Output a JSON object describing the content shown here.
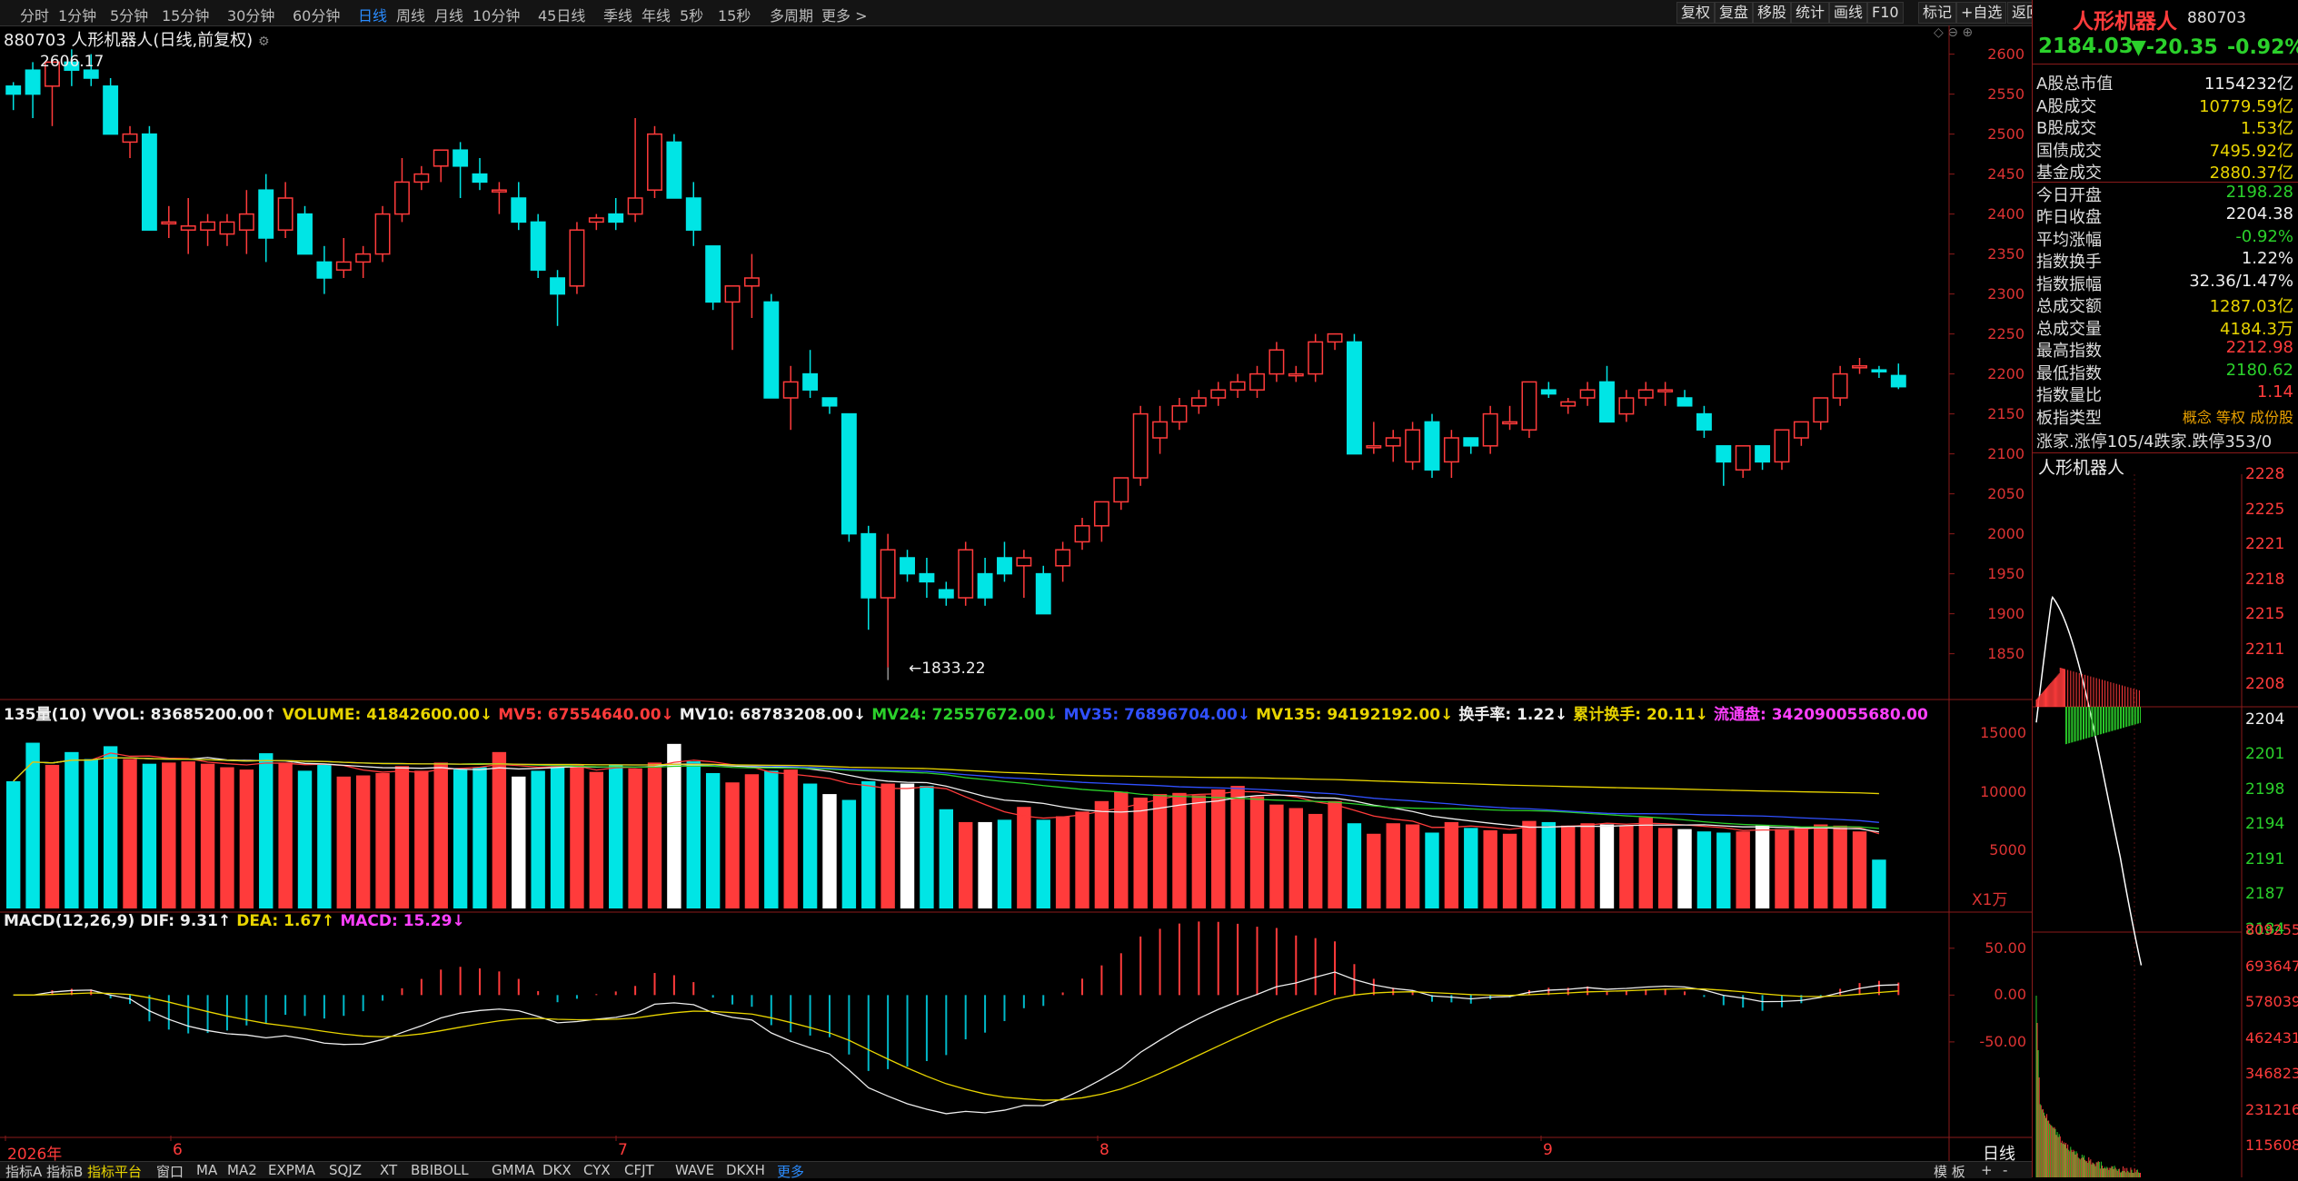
{
  "toolbar": {
    "timeframes": [
      "分时",
      "1分钟",
      "5分钟",
      "15分钟",
      "30分钟",
      "60分钟",
      "日线",
      "周线",
      "月线",
      "10分钟",
      "45日线",
      "季线",
      "年线",
      "5秒",
      "15秒",
      "多周期",
      "更多 >"
    ],
    "active": "日线",
    "right_buttons": [
      "复权",
      "复盘",
      "移股",
      "统计",
      "画线",
      "F10",
      "标记",
      "+自选",
      "返回"
    ]
  },
  "chart_header": {
    "code_title": "880703 人形机器人(日线,前复权)"
  },
  "price_axis": [
    "2600",
    "2550",
    "2500",
    "2450",
    "2400",
    "2350",
    "2300",
    "2250",
    "2200",
    "2150",
    "2100",
    "2050",
    "2000",
    "1950",
    "1900",
    "1850"
  ],
  "annotations": {
    "high": "2606.17",
    "low": "←1833.22"
  },
  "volume_legend": [
    {
      "text": "135量(10) VVOL: 83685200.00↑",
      "color": "#eeeeee"
    },
    {
      "text": "VOLUME: 41842600.00↓",
      "color": "#e8d400"
    },
    {
      "text": "MV5: 67554640.00↓",
      "color": "#ff3b3b"
    },
    {
      "text": "MV10: 68783208.00↓",
      "color": "#eeeeee"
    },
    {
      "text": "MV24: 72557672.00↓",
      "color": "#2bd12b"
    },
    {
      "text": "MV35: 76896704.00↓",
      "color": "#3050ff"
    },
    {
      "text": "MV135: 94192192.00↓",
      "color": "#e8d400"
    },
    {
      "text": "换手率: 1.22↓",
      "color": "#eeeeee"
    },
    {
      "text": "累计换手: 20.11↓",
      "color": "#e8d400"
    },
    {
      "text": "流通盘: 342090055680.00",
      "color": "#ff40ff"
    }
  ],
  "volume_axis": [
    "15000",
    "10000",
    "5000"
  ],
  "volume_unit": "X1万",
  "macd_legend": [
    {
      "text": "MACD(12,26,9) DIF: 9.31↑",
      "color": "#eeeeee"
    },
    {
      "text": "DEA: 1.67↑",
      "color": "#e8d400"
    },
    {
      "text": "MACD: 15.29↓",
      "color": "#ff40ff"
    }
  ],
  "macd_axis": [
    "50.00",
    "0.00",
    "-50.00"
  ],
  "date_axis": [
    {
      "label": "2026年",
      "color": "#ff3b3b"
    },
    {
      "label": "6",
      "color": "#ff3b3b"
    },
    {
      "label": "7",
      "color": "#ff3b3b"
    },
    {
      "label": "8",
      "color": "#ff3b3b"
    },
    {
      "label": "9",
      "color": "#ff3b3b"
    }
  ],
  "period_label": "日线",
  "bottom_tabs": [
    "指标A",
    "指标B",
    "指标平台",
    "窗口",
    "MA",
    "MA2",
    "EXPMA",
    "SQJZ",
    "XT",
    "BBIBOLL",
    "GMMA",
    "DKX",
    "CYX",
    "CFJT",
    "WAVE",
    "DKXH",
    "更多"
  ],
  "bottom_right": [
    "模 板",
    "+",
    "-"
  ],
  "info": {
    "name": "人形机器人",
    "code": "880703",
    "price": "2184.03",
    "change": "▼-20.35",
    "pct": "-0.92%",
    "rows": [
      {
        "k": "A股总市值",
        "v": "1154232亿",
        "c": "#eeeeee"
      },
      {
        "k": "A股成交",
        "v": "10779.59亿",
        "c": "#e8d400"
      },
      {
        "k": "B股成交",
        "v": "1.53亿",
        "c": "#e8d400"
      },
      {
        "k": "国债成交",
        "v": "7495.92亿",
        "c": "#e8d400"
      },
      {
        "k": "基金成交",
        "v": "2880.37亿",
        "c": "#e8d400"
      },
      {
        "k": "今日开盘",
        "v": "2198.28",
        "c": "#2bd12b"
      },
      {
        "k": "昨日收盘",
        "v": "2204.38",
        "c": "#eeeeee"
      },
      {
        "k": "平均涨幅",
        "v": "-0.92%",
        "c": "#2bd12b"
      },
      {
        "k": "指数换手",
        "v": "1.22%",
        "c": "#eeeeee"
      },
      {
        "k": "指数振幅",
        "v": "32.36/1.47%",
        "c": "#eeeeee"
      },
      {
        "k": "总成交额",
        "v": "1287.03亿",
        "c": "#e8d400"
      },
      {
        "k": "总成交量",
        "v": "4184.3万",
        "c": "#e8d400"
      },
      {
        "k": "最高指数",
        "v": "2212.98",
        "c": "#ff3b3b"
      },
      {
        "k": "最低指数",
        "v": "2180.62",
        "c": "#2bd12b"
      },
      {
        "k": "指数量比",
        "v": "1.14",
        "c": "#ff3b3b"
      }
    ],
    "sector_type_label": "板指类型",
    "sector_type_value": "概念 等权 成份股",
    "updown": "涨家.涨停105/4跌家.跌停353/0",
    "mini_title": "人形机器人",
    "mini_price_axis": [
      "2228",
      "2225",
      "2221",
      "2218",
      "2215",
      "2211",
      "2208",
      "2204",
      "2201",
      "2198",
      "2194",
      "2191",
      "2187",
      "2184"
    ],
    "mini_vol_axis": [
      "809255",
      "693647",
      "578039",
      "462431",
      "346823",
      "231216",
      "115608"
    ]
  },
  "chart_data": {
    "type": "candlestick",
    "price_range": [
      1820,
      2620
    ],
    "candles": [
      [
        2560,
        2565,
        2530,
        2550
      ],
      [
        2580,
        2590,
        2520,
        2550
      ],
      [
        2560,
        2580,
        2510,
        2590
      ],
      [
        2590,
        2606,
        2560,
        2580
      ],
      [
        2580,
        2600,
        2560,
        2570
      ],
      [
        2560,
        2570,
        2500,
        2500
      ],
      [
        2490,
        2510,
        2470,
        2500
      ],
      [
        2500,
        2510,
        2380,
        2380
      ],
      [
        2390,
        2410,
        2370,
        2390
      ],
      [
        2380,
        2420,
        2350,
        2385
      ],
      [
        2380,
        2400,
        2360,
        2390
      ],
      [
        2375,
        2400,
        2360,
        2390
      ],
      [
        2380,
        2430,
        2350,
        2400
      ],
      [
        2430,
        2450,
        2340,
        2370
      ],
      [
        2380,
        2440,
        2370,
        2420
      ],
      [
        2400,
        2410,
        2350,
        2350
      ],
      [
        2340,
        2360,
        2300,
        2320
      ],
      [
        2330,
        2370,
        2320,
        2340
      ],
      [
        2340,
        2360,
        2320,
        2350
      ],
      [
        2350,
        2410,
        2340,
        2400
      ],
      [
        2400,
        2470,
        2390,
        2440
      ],
      [
        2440,
        2460,
        2430,
        2450
      ],
      [
        2460,
        2480,
        2440,
        2480
      ],
      [
        2480,
        2490,
        2420,
        2460
      ],
      [
        2450,
        2470,
        2430,
        2440
      ],
      [
        2430,
        2440,
        2400,
        2430
      ],
      [
        2420,
        2440,
        2380,
        2390
      ],
      [
        2390,
        2400,
        2320,
        2330
      ],
      [
        2320,
        2330,
        2260,
        2300
      ],
      [
        2310,
        2390,
        2300,
        2380
      ],
      [
        2390,
        2400,
        2380,
        2395
      ],
      [
        2400,
        2420,
        2380,
        2390
      ],
      [
        2400,
        2520,
        2390,
        2420
      ],
      [
        2430,
        2510,
        2420,
        2500
      ],
      [
        2490,
        2500,
        2420,
        2420
      ],
      [
        2420,
        2440,
        2360,
        2380
      ],
      [
        2360,
        2360,
        2280,
        2290
      ],
      [
        2290,
        2300,
        2230,
        2310
      ],
      [
        2310,
        2350,
        2270,
        2320
      ],
      [
        2290,
        2300,
        2170,
        2170
      ],
      [
        2170,
        2210,
        2130,
        2190
      ],
      [
        2200,
        2230,
        2170,
        2180
      ],
      [
        2170,
        2170,
        2150,
        2160
      ],
      [
        2150,
        2150,
        1990,
        2000
      ],
      [
        2000,
        2010,
        1880,
        1920
      ],
      [
        1920,
        2000,
        1833,
        1980
      ],
      [
        1970,
        1980,
        1940,
        1950
      ],
      [
        1950,
        1970,
        1920,
        1940
      ],
      [
        1930,
        1940,
        1910,
        1920
      ],
      [
        1920,
        1990,
        1910,
        1980
      ],
      [
        1950,
        1970,
        1910,
        1920
      ],
      [
        1970,
        1990,
        1940,
        1950
      ],
      [
        1960,
        1980,
        1920,
        1970
      ],
      [
        1950,
        1960,
        1910,
        1900
      ],
      [
        1960,
        1990,
        1940,
        1980
      ],
      [
        1990,
        2020,
        1980,
        2010
      ],
      [
        2010,
        2030,
        1990,
        2040
      ],
      [
        2040,
        2070,
        2030,
        2070
      ],
      [
        2070,
        2160,
        2060,
        2150
      ],
      [
        2120,
        2160,
        2100,
        2140
      ],
      [
        2140,
        2170,
        2130,
        2160
      ],
      [
        2160,
        2180,
        2150,
        2170
      ],
      [
        2170,
        2190,
        2160,
        2180
      ],
      [
        2180,
        2200,
        2170,
        2190
      ],
      [
        2180,
        2210,
        2170,
        2200
      ],
      [
        2200,
        2240,
        2190,
        2230
      ],
      [
        2200,
        2210,
        2190,
        2200
      ],
      [
        2200,
        2250,
        2190,
        2240
      ],
      [
        2240,
        2250,
        2230,
        2250
      ],
      [
        2240,
        2250,
        2100,
        2100
      ],
      [
        2110,
        2140,
        2100,
        2110
      ],
      [
        2110,
        2130,
        2090,
        2120
      ],
      [
        2090,
        2140,
        2080,
        2130
      ],
      [
        2140,
        2150,
        2070,
        2080
      ],
      [
        2090,
        2130,
        2070,
        2120
      ],
      [
        2120,
        2120,
        2100,
        2110
      ],
      [
        2110,
        2160,
        2100,
        2150
      ],
      [
        2140,
        2160,
        2130,
        2140
      ],
      [
        2130,
        2190,
        2120,
        2190
      ],
      [
        2180,
        2190,
        2170,
        2175
      ],
      [
        2160,
        2170,
        2150,
        2165
      ],
      [
        2170,
        2190,
        2160,
        2180
      ],
      [
        2190,
        2210,
        2140,
        2140
      ],
      [
        2150,
        2180,
        2140,
        2170
      ],
      [
        2170,
        2190,
        2160,
        2180
      ],
      [
        2180,
        2190,
        2160,
        2180
      ],
      [
        2170,
        2180,
        2160,
        2160
      ],
      [
        2150,
        2160,
        2120,
        2130
      ],
      [
        2110,
        2110,
        2060,
        2090
      ],
      [
        2080,
        2090,
        2070,
        2110
      ],
      [
        2110,
        2110,
        2080,
        2090
      ],
      [
        2090,
        2130,
        2080,
        2130
      ],
      [
        2120,
        2140,
        2110,
        2140
      ],
      [
        2140,
        2170,
        2130,
        2170
      ],
      [
        2170,
        2210,
        2160,
        2200
      ],
      [
        2210,
        2220,
        2200,
        2210
      ],
      [
        2205,
        2210,
        2195,
        2203
      ],
      [
        2198,
        2213,
        2181,
        2184
      ]
    ],
    "volumes": [
      10900,
      14200,
      12300,
      13400,
      12800,
      13900,
      12800,
      12400,
      12500,
      12600,
      12400,
      12100,
      11900,
      13300,
      12500,
      11800,
      12300,
      11300,
      11400,
      11600,
      12200,
      11800,
      12500,
      11900,
      12100,
      13400,
      11300,
      11800,
      12200,
      12300,
      11700,
      12300,
      12000,
      12500,
      14100,
      12600,
      11600,
      10800,
      11500,
      11800,
      11900,
      10700,
      9800,
      9300,
      10900,
      10700,
      10700,
      10500,
      8500,
      7400,
      7400,
      7600,
      8700,
      7600,
      7900,
      8300,
      9200,
      10000,
      9500,
      9800,
      9900,
      9700,
      10200,
      10500,
      9600,
      8900,
      8600,
      8100,
      9200,
      7300,
      6400,
      7300,
      7200,
      6500,
      7400,
      6900,
      6700,
      6400,
      7500,
      7400,
      7100,
      7300,
      7200,
      7100,
      7800,
      6900,
      6800,
      6600,
      6500,
      6600,
      7100,
      6800,
      6900,
      7200,
      7100,
      6600,
      4184
    ]
  }
}
